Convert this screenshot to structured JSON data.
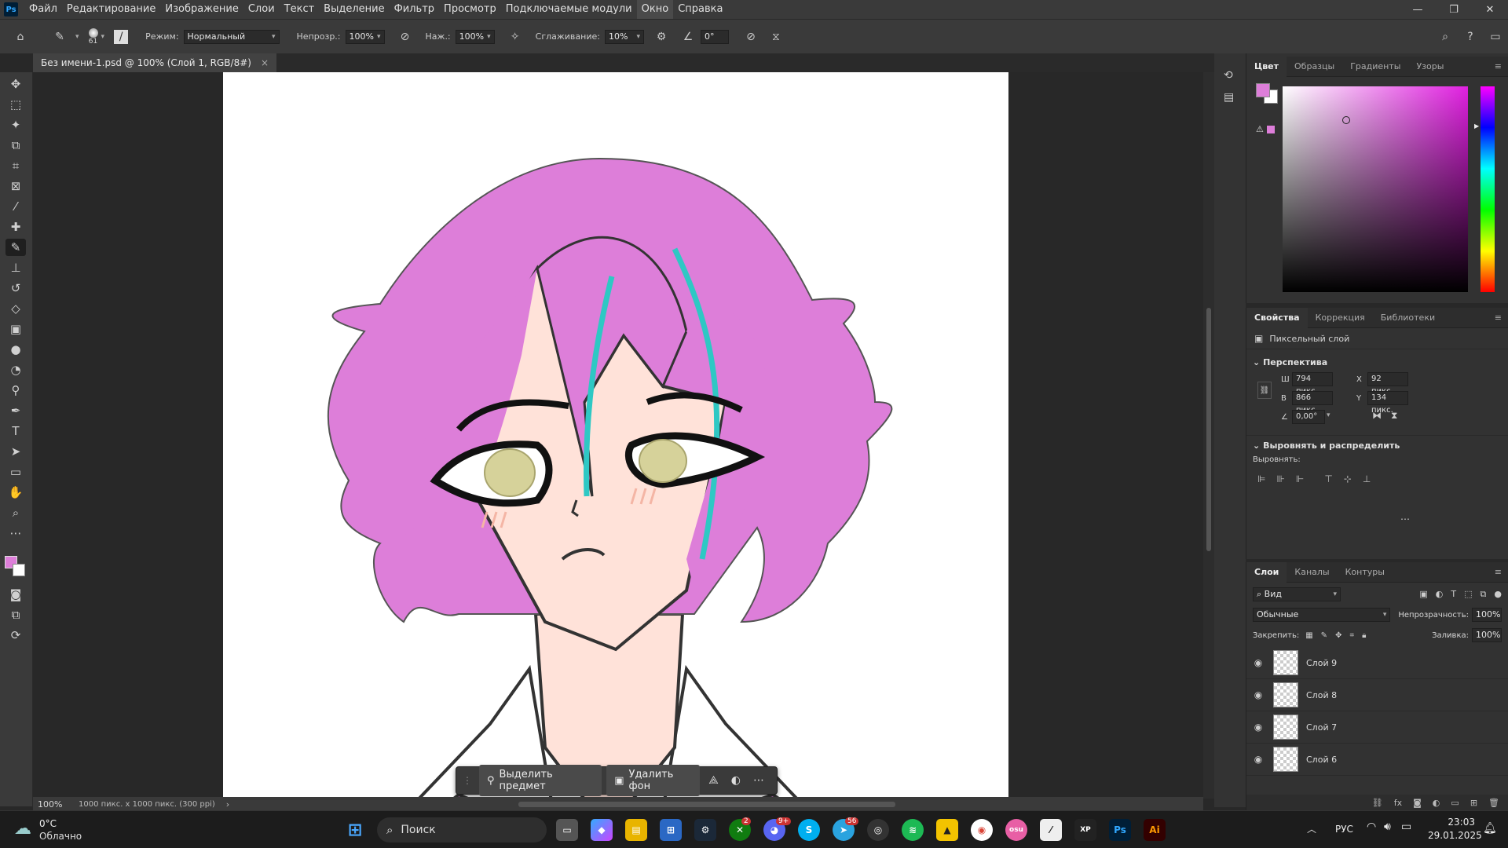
{
  "app": {
    "logo": "Ps",
    "menu": [
      "Файл",
      "Редактирование",
      "Изображение",
      "Слои",
      "Текст",
      "Выделение",
      "Фильтр",
      "Просмотр",
      "Подключаемые модули",
      "Окно",
      "Справка"
    ]
  },
  "options": {
    "brush_size": "61",
    "mode_label": "Режим:",
    "mode_value": "Нормальный",
    "opacity_label": "Непрозр.:",
    "opacity_value": "100%",
    "pressure_label": "Наж.:",
    "pressure_value": "100%",
    "smoothing_label": "Сглаживание:",
    "smoothing_value": "10%",
    "angle_value": "0°"
  },
  "document": {
    "tab_title": "Без имени-1.psd @ 100% (Слой 1, RGB/8#)",
    "zoom": "100%",
    "info": "1000 пикс. x 1000 пикс. (300 ppi)"
  },
  "context_bar": {
    "select_subject": "Выделить предмет",
    "remove_bg": "Удалить фон"
  },
  "color_panel": {
    "tabs": [
      "Цвет",
      "Образцы",
      "Градиенты",
      "Узоры"
    ],
    "foreground": "#dd7ed9",
    "background": "#ffffff"
  },
  "properties": {
    "tabs": [
      "Свойства",
      "Коррекция",
      "Библиотеки"
    ],
    "layer_type": "Пиксельный слой",
    "transform_title": "Перспектива",
    "w_label": "Ш",
    "w_value": "794 пикс.",
    "h_label": "В",
    "h_value": "866 пикс.",
    "x_label": "X",
    "x_value": "92 пикс.",
    "y_label": "Y",
    "y_value": "134 пикс.",
    "angle_value": "0,00°",
    "align_title": "Выровнять и распределить",
    "align_label": "Выровнять:"
  },
  "layers_panel": {
    "tabs": [
      "Слои",
      "Каналы",
      "Контуры"
    ],
    "filter_placeholder": "Вид",
    "blend_mode": "Обычные",
    "opacity_label": "Непрозрачность:",
    "opacity_value": "100%",
    "lock_label": "Закрепить:",
    "fill_label": "Заливка:",
    "fill_value": "100%",
    "layers": [
      {
        "name": "Слой 9"
      },
      {
        "name": "Слой 8"
      },
      {
        "name": "Слой 7"
      },
      {
        "name": "Слой 6"
      }
    ]
  },
  "taskbar": {
    "weather_temp": "0°C",
    "weather_desc": "Облачно",
    "search_placeholder": "Поиск",
    "language": "РУС",
    "time": "23:03",
    "date": "29.01.2025",
    "xbox_badge": "2",
    "discord_badge": "9+",
    "telegram_badge": "56"
  },
  "colors": {
    "hair": "#dd7ed9",
    "skin": "#ffe2d9",
    "streak": "#2ec8c4",
    "eye": "#d6d29a"
  }
}
